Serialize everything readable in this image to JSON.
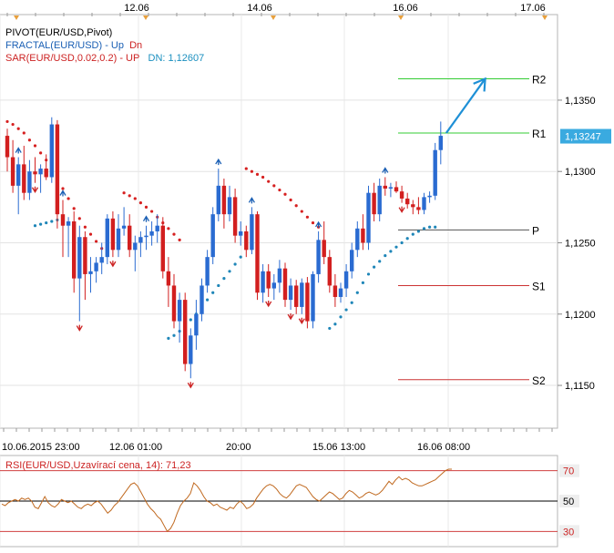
{
  "chart_data": [
    {
      "type": "candlestick",
      "symbol": "EUR/USD",
      "top_dates": [
        "12.06",
        "14.06",
        "16.06",
        "17.06"
      ],
      "x_tick_labels": [
        "10.06.2015 23:00",
        "12.06 01:00",
        "20:00",
        "15.06 13:00",
        "16.06 08:00"
      ],
      "y_ticks": [
        "1,1350",
        "1,1300",
        "1,1250",
        "1,1200",
        "1,1150"
      ],
      "ylim": [
        1.112,
        1.141
      ],
      "current_price_label": "1,13247",
      "current_price": 1.13247,
      "legend": {
        "pivot": "PIVOT(EUR/USD,Pivot)",
        "fractal_name": "FRACTAL(EUR/USD)",
        "fractal_sep": " - ",
        "fractal_up": "Up",
        "fractal_dn": "Dn",
        "sar_name": "SAR(EUR/USD,0.02,0.2)",
        "sar_sep": " - ",
        "sar_up": "UP",
        "sar_dn": "DN: 1,12607"
      },
      "pivot_levels": [
        {
          "name": "R2",
          "value": 1.1365,
          "color": "#33cc33"
        },
        {
          "name": "R1",
          "value": 1.1327,
          "color": "#33cc33"
        },
        {
          "name": "P",
          "value": 1.1259,
          "color": "#555555"
        },
        {
          "name": "S1",
          "value": 1.122,
          "color": "#cc3333"
        },
        {
          "name": "S2",
          "value": 1.1154,
          "color": "#cc3333"
        }
      ],
      "candles": [
        [
          1.1325,
          1.133,
          1.13,
          1.131
        ],
        [
          1.131,
          1.1322,
          1.1285,
          1.129
        ],
        [
          1.129,
          1.131,
          1.127,
          1.1305
        ],
        [
          1.1305,
          1.1318,
          1.128,
          1.1285
        ],
        [
          1.1285,
          1.1308,
          1.128,
          1.13
        ],
        [
          1.13,
          1.131,
          1.1292,
          1.1298
        ],
        [
          1.1298,
          1.1305,
          1.1285,
          1.1302
        ],
        [
          1.1302,
          1.1312,
          1.1294,
          1.1296
        ],
        [
          1.1296,
          1.1338,
          1.1292,
          1.1333
        ],
        [
          1.1333,
          1.1336,
          1.126,
          1.127
        ],
        [
          1.127,
          1.128,
          1.124,
          1.1262
        ],
        [
          1.1262,
          1.1268,
          1.124,
          1.1265
        ],
        [
          1.1265,
          1.1272,
          1.1215,
          1.1225
        ],
        [
          1.1225,
          1.1262,
          1.1195,
          1.1254
        ],
        [
          1.1254,
          1.1258,
          1.121,
          1.1228
        ],
        [
          1.1228,
          1.124,
          1.1215,
          1.123
        ],
        [
          1.123,
          1.124,
          1.1222,
          1.1236
        ],
        [
          1.1236,
          1.125,
          1.1228,
          1.124
        ],
        [
          1.124,
          1.127,
          1.1235,
          1.1267
        ],
        [
          1.1267,
          1.1272,
          1.124,
          1.1245
        ],
        [
          1.1245,
          1.127,
          1.124,
          1.126
        ],
        [
          1.126,
          1.1275,
          1.1255,
          1.1262
        ],
        [
          1.1262,
          1.127,
          1.124,
          1.1245
        ],
        [
          1.1245,
          1.1255,
          1.123,
          1.125
        ],
        [
          1.125,
          1.1258,
          1.124,
          1.1254
        ],
        [
          1.1254,
          1.1262,
          1.1245,
          1.1255
        ],
        [
          1.1255,
          1.1265,
          1.1248,
          1.1258
        ],
        [
          1.1258,
          1.127,
          1.125,
          1.1262
        ],
        [
          1.1262,
          1.1268,
          1.1225,
          1.123
        ],
        [
          1.123,
          1.124,
          1.1205,
          1.122
        ],
        [
          1.122,
          1.1228,
          1.119,
          1.1195
        ],
        [
          1.1195,
          1.1215,
          1.118,
          1.121
        ],
        [
          1.121,
          1.1215,
          1.116,
          1.1165
        ],
        [
          1.1165,
          1.119,
          1.1155,
          1.1185
        ],
        [
          1.1185,
          1.121,
          1.1175,
          1.12
        ],
        [
          1.12,
          1.1225,
          1.1195,
          1.122
        ],
        [
          1.122,
          1.1245,
          1.1215,
          1.124
        ],
        [
          1.124,
          1.1275,
          1.1235,
          1.127
        ],
        [
          1.127,
          1.1302,
          1.1265,
          1.129
        ],
        [
          1.129,
          1.1295,
          1.126,
          1.127
        ],
        [
          1.127,
          1.129,
          1.1265,
          1.1282
        ],
        [
          1.1282,
          1.1288,
          1.125,
          1.1255
        ],
        [
          1.1255,
          1.1265,
          1.1248,
          1.1258
        ],
        [
          1.1258,
          1.1262,
          1.124,
          1.1245
        ],
        [
          1.1245,
          1.1275,
          1.1242,
          1.127
        ],
        [
          1.127,
          1.1272,
          1.121,
          1.1215
        ],
        [
          1.1215,
          1.1235,
          1.1208,
          1.123
        ],
        [
          1.123,
          1.1235,
          1.1212,
          1.1218
        ],
        [
          1.1218,
          1.1228,
          1.121,
          1.1222
        ],
        [
          1.1222,
          1.1238,
          1.1215,
          1.1232
        ],
        [
          1.1232,
          1.1236,
          1.1205,
          1.121
        ],
        [
          1.121,
          1.1225,
          1.1203,
          1.122
        ],
        [
          1.122,
          1.1224,
          1.12,
          1.1205
        ],
        [
          1.1205,
          1.1225,
          1.12,
          1.1222
        ],
        [
          1.1222,
          1.1226,
          1.119,
          1.1195
        ],
        [
          1.1195,
          1.123,
          1.119,
          1.1228
        ],
        [
          1.1228,
          1.1258,
          1.1222,
          1.1252
        ],
        [
          1.1252,
          1.1265,
          1.1235,
          1.124
        ],
        [
          1.124,
          1.1245,
          1.1215,
          1.122
        ],
        [
          1.122,
          1.1228,
          1.1205,
          1.1212
        ],
        [
          1.1212,
          1.1222,
          1.1208,
          1.1218
        ],
        [
          1.1218,
          1.1235,
          1.1212,
          1.123
        ],
        [
          1.123,
          1.125,
          1.1225,
          1.1245
        ],
        [
          1.1245,
          1.1265,
          1.124,
          1.126
        ],
        [
          1.126,
          1.127,
          1.1245,
          1.125
        ],
        [
          1.125,
          1.129,
          1.1245,
          1.1285
        ],
        [
          1.1285,
          1.1292,
          1.1265,
          1.127
        ],
        [
          1.127,
          1.1295,
          1.1265,
          1.129
        ],
        [
          1.129,
          1.1296,
          1.1283,
          1.1288
        ],
        [
          1.1288,
          1.1292,
          1.1282,
          1.1289
        ],
        [
          1.1289,
          1.1293,
          1.1285,
          1.1286
        ],
        [
          1.1286,
          1.129,
          1.1278,
          1.1281
        ],
        [
          1.1281,
          1.1285,
          1.1274,
          1.1277
        ],
        [
          1.1277,
          1.128,
          1.127,
          1.1275
        ],
        [
          1.1275,
          1.1282,
          1.127,
          1.1273
        ],
        [
          1.1273,
          1.1285,
          1.127,
          1.1282
        ],
        [
          1.1282,
          1.1286,
          1.1278,
          1.1283
        ],
        [
          1.1283,
          1.132,
          1.128,
          1.1315
        ],
        [
          1.1315,
          1.1335,
          1.1305,
          1.1325
        ]
      ],
      "sar_up": [
        1.1335,
        1.1333,
        1.133,
        1.1327,
        1.1322,
        1.1318,
        1.1313,
        1.1308,
        1.1302,
        1.1295,
        1.1288,
        1.1281,
        1.1274,
        1.1267,
        1.1261,
        1.1256,
        1.1251,
        1.1246,
        null,
        null,
        null,
        1.1285,
        1.1283,
        1.1281,
        1.1278,
        1.1275,
        1.1272,
        1.1268,
        1.1264,
        1.126,
        1.1256,
        1.1252,
        null,
        null,
        null,
        null,
        null,
        null,
        null,
        null,
        null,
        null,
        null,
        1.1302,
        1.13,
        1.1298,
        1.1296,
        1.1293,
        1.129,
        1.1287,
        1.1284,
        1.128,
        1.1276,
        1.1272,
        1.1268,
        1.1264,
        1.1261,
        null,
        null,
        null,
        null,
        null,
        null,
        null,
        null,
        null,
        null,
        null,
        null,
        null,
        null,
        null,
        null,
        null,
        null,
        null,
        null,
        null
      ],
      "sar_dn": [
        null,
        null,
        null,
        null,
        null,
        1.1262,
        1.1263,
        1.1264,
        1.1265,
        1.1266,
        null,
        null,
        null,
        null,
        null,
        null,
        null,
        null,
        null,
        null,
        null,
        null,
        null,
        null,
        null,
        null,
        null,
        null,
        null,
        1.1183,
        1.1185,
        1.1188,
        1.1192,
        1.1196,
        1.12,
        1.1205,
        1.121,
        1.1215,
        1.122,
        1.1225,
        1.123,
        1.1235,
        1.124,
        null,
        null,
        null,
        null,
        null,
        null,
        null,
        null,
        null,
        null,
        null,
        null,
        null,
        null,
        null,
        1.119,
        1.1193,
        1.1198,
        1.1203,
        1.1208,
        1.1215,
        1.1222,
        1.1228,
        1.1233,
        1.1237,
        1.1241,
        1.1244,
        1.1247,
        1.125,
        1.1253,
        1.1256,
        1.1258,
        1.126,
        1.1261,
        1.1261
      ],
      "fractals_up_idx": [
        2,
        10,
        25,
        38,
        44,
        56,
        68
      ],
      "fractals_dn_idx": [
        5,
        13,
        19,
        33,
        47,
        51,
        53,
        71
      ],
      "projection_arrow": {
        "from_idx": 79,
        "from": 1.1327,
        "to_idx": 86,
        "to": 1.1365,
        "color": "#1e90d6"
      }
    },
    {
      "type": "line",
      "name": "RSI(EUR/USD,Uzavírací cena, 14): 71,23",
      "ylim": [
        20,
        80
      ],
      "levels": [
        70,
        50,
        30
      ],
      "level_labels": [
        "70",
        "50",
        "30"
      ],
      "values": [
        48,
        47,
        49,
        50,
        51,
        50,
        52,
        51,
        52,
        50,
        46,
        45,
        49,
        53,
        49,
        47,
        46,
        48,
        51,
        50,
        49,
        50,
        48,
        46,
        45,
        47,
        48,
        47,
        49,
        50,
        48,
        45,
        42,
        44,
        47,
        49,
        52,
        55,
        58,
        61,
        62,
        60,
        56,
        52,
        48,
        45,
        43,
        40,
        38,
        34,
        30,
        32,
        36,
        42,
        47,
        50,
        52,
        55,
        62,
        60,
        57,
        53,
        50,
        49,
        47,
        48,
        46,
        45,
        44,
        46,
        45,
        48,
        50,
        48,
        45,
        46,
        48,
        52,
        55,
        58,
        60,
        61,
        60,
        58,
        55,
        53,
        52,
        54,
        57,
        60,
        61,
        60,
        59,
        56,
        53,
        51,
        50,
        52,
        54,
        56,
        55,
        53,
        51,
        52,
        55,
        57,
        56,
        54,
        52,
        53,
        55,
        56,
        55,
        54,
        55,
        57,
        60,
        63,
        61,
        64,
        66,
        64,
        65,
        64,
        62,
        61,
        60,
        60,
        61,
        62,
        63,
        64,
        66,
        68,
        70,
        71,
        71
      ]
    }
  ]
}
